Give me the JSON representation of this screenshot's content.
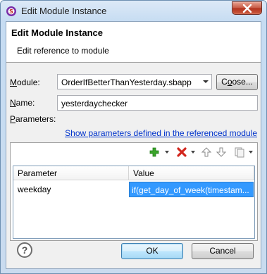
{
  "window": {
    "title": "Edit Module Instance",
    "close_glyph": "✕"
  },
  "banner": {
    "title": "Edit Module Instance",
    "subtitle": "Edit reference to module"
  },
  "form": {
    "module_label": "Module:",
    "module_label_rest": "odule:",
    "module_label_accel": "M",
    "module_value": "OrderIfBetterThanYesterday.sbapp",
    "choose_button": "Choose...",
    "choose_accel": "o",
    "name_label": "Name:",
    "name_label_accel": "N",
    "name_label_rest": "ame:",
    "name_value": "yesterdaychecker",
    "parameters_label": "Parameters:",
    "parameters_label_accel": "P",
    "parameters_label_rest": "arameters:",
    "show_params_link": "Show parameters defined in the referenced module"
  },
  "toolbar": {
    "icons": [
      "add-icon",
      "delete-icon",
      "move-up-icon",
      "move-down-icon",
      "copy-icon"
    ]
  },
  "table": {
    "columns": [
      "Parameter",
      "Value"
    ],
    "rows": [
      {
        "parameter": "weekday",
        "value": "if(get_day_of_week(timestam..."
      }
    ]
  },
  "footer": {
    "help_glyph": "?",
    "ok_button": "OK",
    "cancel_button": "Cancel"
  },
  "colors": {
    "link": "#0033cc",
    "selection": "#3399ff",
    "add_icon": "#3aa52a",
    "delete_icon": "#d2261d"
  }
}
